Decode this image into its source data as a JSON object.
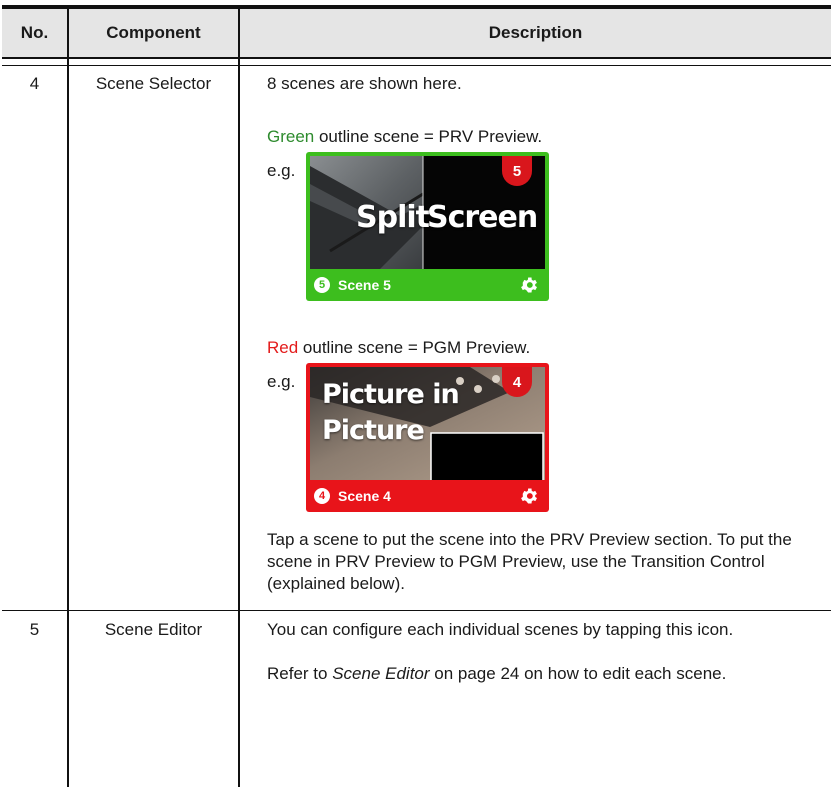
{
  "header": {
    "no": "No.",
    "component": "Component",
    "description": "Description"
  },
  "rows": [
    {
      "no": "4",
      "component": "Scene Selector",
      "intro": "8 scenes are shown here.",
      "green_word": "Green",
      "green_rest": " outline scene = PRV Preview.",
      "eg1": "e.g.",
      "red_word": "Red",
      "red_rest": " outline scene = PGM Preview.",
      "eg2": "e.g.",
      "tap_text": "Tap a scene to put the scene into the PRV Preview section. To put the scene in PRV Preview to PGM Preview, use the Transition Control (explained below)."
    },
    {
      "no": "5",
      "component": "Scene Editor",
      "desc_line1": "You can configure each individual scenes by tapping this icon.",
      "refer_pre": "Refer to ",
      "refer_italic": "Scene Editor",
      "refer_post": " on page 24 on how to edit each scene."
    }
  ],
  "thumb_green": {
    "badge": "5",
    "overlay_left": "Split",
    "overlay_right": "Screen",
    "num": "5",
    "label": "Scene 5",
    "frame_color": "#3dbe1e",
    "icon": "gear-icon"
  },
  "thumb_red": {
    "badge": "4",
    "overlay_line1": "Picture in",
    "overlay_line2": "Picture",
    "num": "4",
    "label": "Scene 4",
    "frame_color": "#e8141a",
    "icon": "gear-icon"
  }
}
